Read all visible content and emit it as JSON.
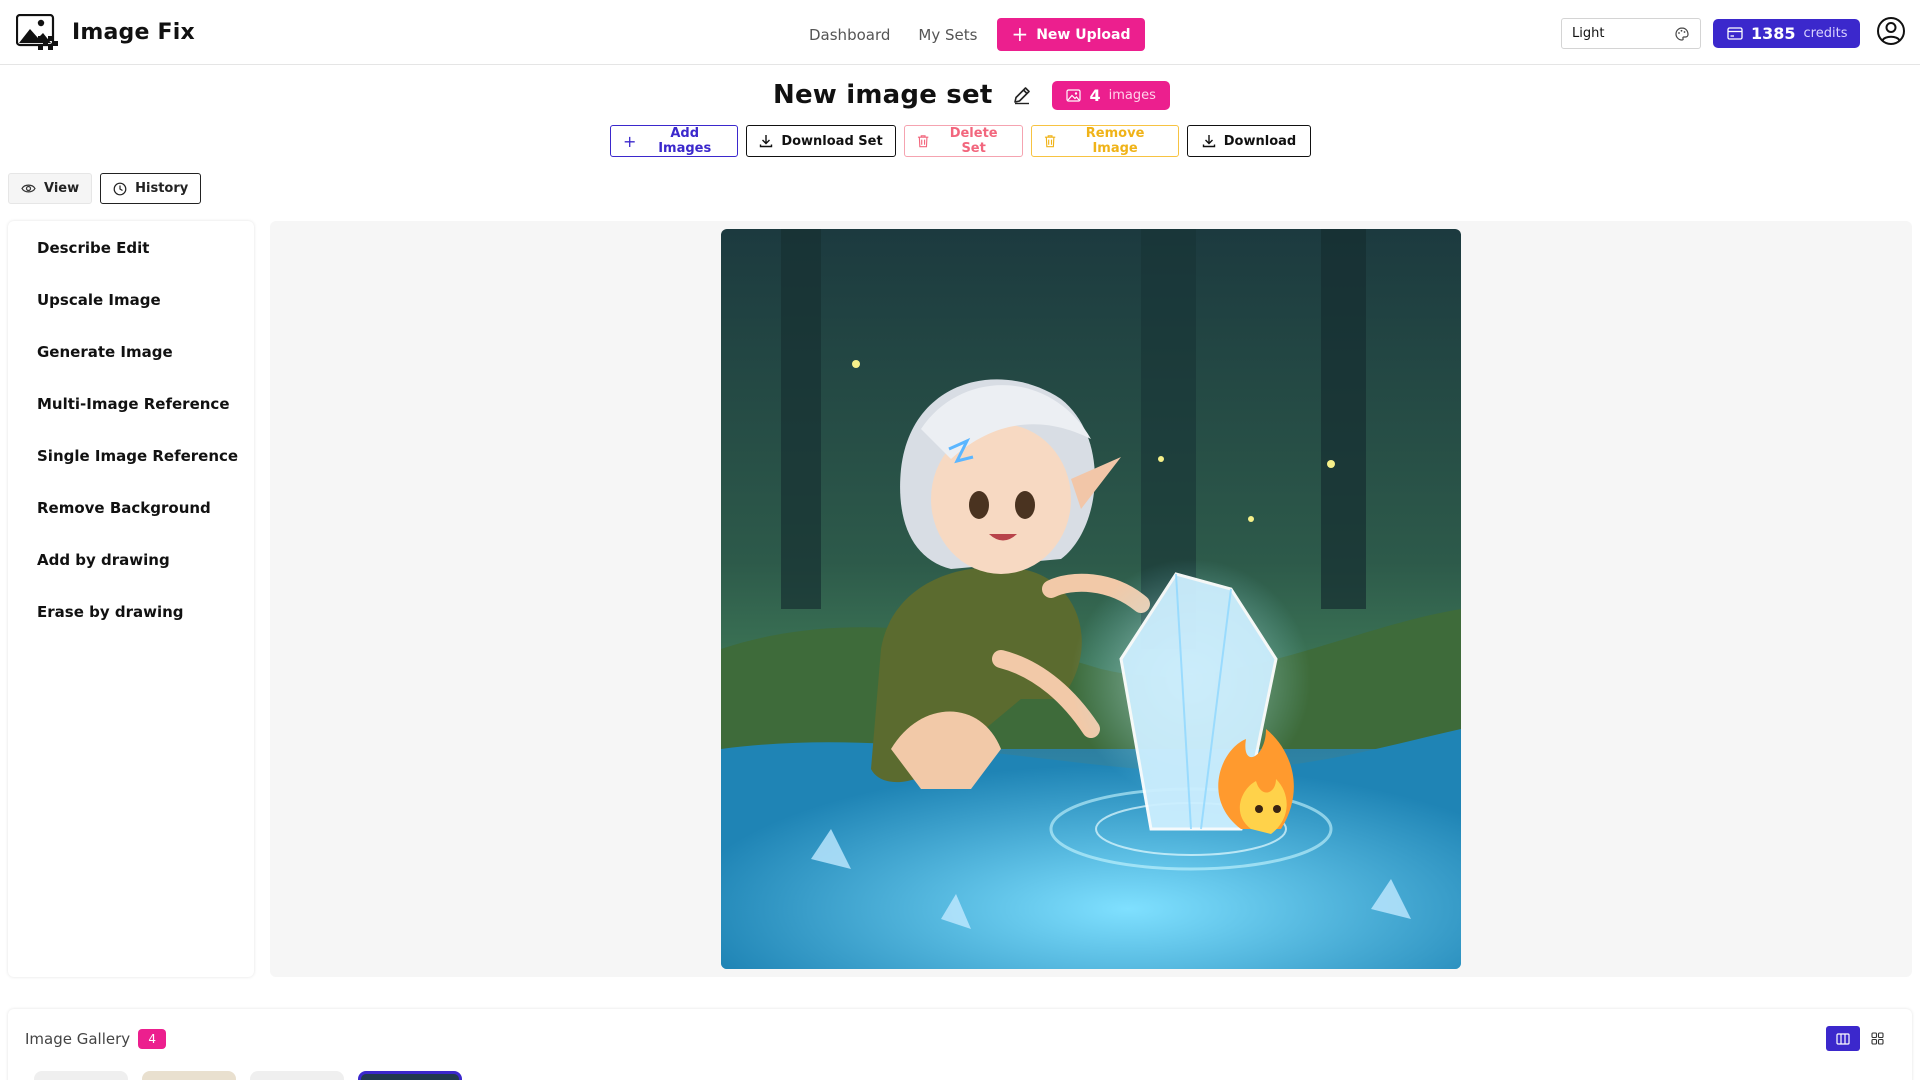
{
  "brand": {
    "name": "Image Fix"
  },
  "nav": {
    "dashboard": "Dashboard",
    "my_sets": "My Sets",
    "new_upload": "New Upload"
  },
  "theme": {
    "selected": "Light"
  },
  "credits": {
    "amount": "1385",
    "label": "credits"
  },
  "set": {
    "title": "New image set",
    "image_count": "4",
    "images_label": "images"
  },
  "actions": {
    "add_images": "Add Images",
    "download_set": "Download Set",
    "delete_set": "Delete Set",
    "remove_image": "Remove Image",
    "download": "Download"
  },
  "mode_toggle": {
    "view": "View",
    "history": "History",
    "active": "history"
  },
  "tools": [
    "Describe Edit",
    "Upscale Image",
    "Generate Image",
    "Multi-Image Reference",
    "Single Image Reference",
    "Remove Background",
    "Add by drawing",
    "Erase by drawing"
  ],
  "gallery": {
    "title": "Image Gallery",
    "count": "4",
    "layout": "columns"
  },
  "colors": {
    "brand_pink": "#ec1f8e",
    "brand_indigo": "#3b28cc",
    "danger": "#f2667d",
    "warning": "#f0b318"
  },
  "icons": {
    "logo": "image-fix-logo",
    "theme": "palette-icon",
    "credits": "credit-card-icon",
    "account": "user-circle-icon"
  }
}
